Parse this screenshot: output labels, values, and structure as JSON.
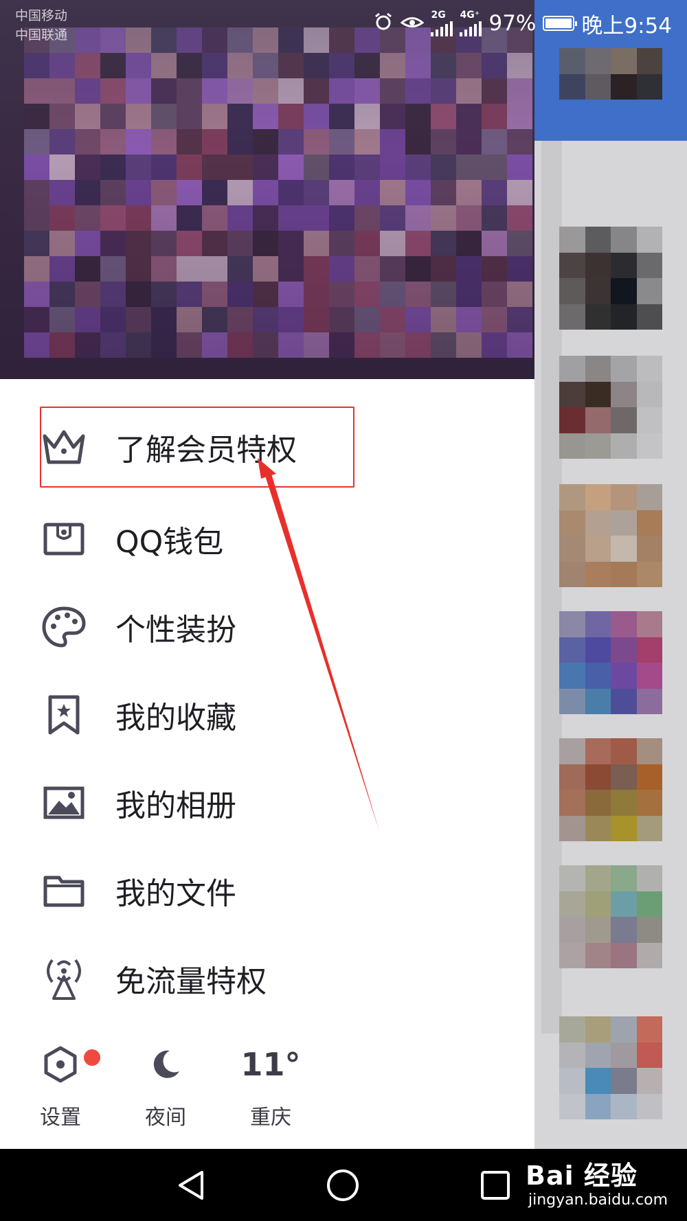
{
  "status_bar": {
    "carrier_1": "中国移动",
    "carrier_2": "中国联通",
    "net_2g": "2G",
    "net_4g": "4G⁺",
    "battery_percent": "97%",
    "time": "晚上9:54",
    "icons": [
      "alarm-icon",
      "eye-comfort-icon",
      "signal-icon",
      "battery-icon"
    ]
  },
  "menu": {
    "items": [
      {
        "label": "了解会员特权",
        "icon": "crown-icon"
      },
      {
        "label": "QQ钱包",
        "icon": "wallet-icon"
      },
      {
        "label": "个性装扮",
        "icon": "palette-icon"
      },
      {
        "label": "我的收藏",
        "icon": "bookmark-star-icon"
      },
      {
        "label": "我的相册",
        "icon": "image-icon"
      },
      {
        "label": "我的文件",
        "icon": "folder-icon"
      },
      {
        "label": "免流量特权",
        "icon": "broadcast-icon"
      }
    ]
  },
  "bottom": {
    "settings_label": "设置",
    "night_label": "夜间",
    "temperature": "11°",
    "city": "重庆"
  },
  "nav_bar": {
    "buttons": [
      "back-icon",
      "home-icon",
      "recents-icon"
    ]
  },
  "watermark": {
    "main": "Bai 经验",
    "sub": "jingyan.baidu.com"
  },
  "colors": {
    "accent_red": "#e8302a",
    "icon_gray": "#4a4a58",
    "badge_red": "#f04a3f",
    "background_blue": "#3f6fc8"
  }
}
